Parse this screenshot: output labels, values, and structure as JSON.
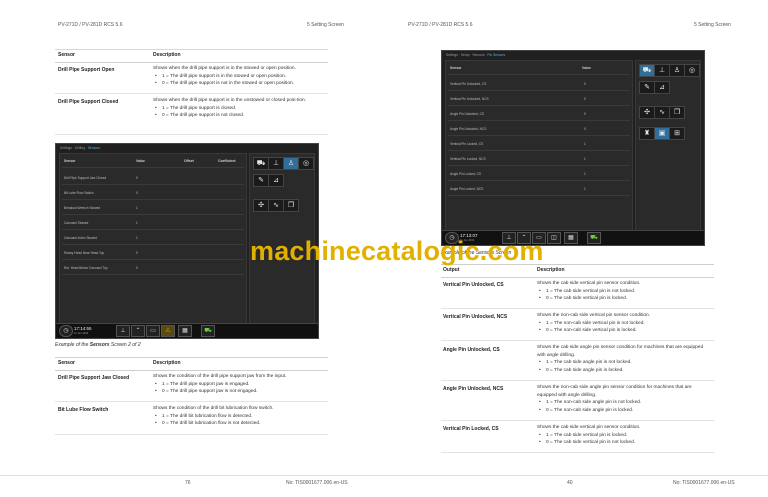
{
  "left_page": {
    "header_left": "PV-271D / PV-281D RCS 5.6",
    "header_right": "5 Setting Screen",
    "table1": {
      "col_sensor": "Sensor",
      "col_desc": "Description",
      "rows": [
        {
          "name": "Drill Pipe Support Open",
          "desc": "Shows when the drill pipe support is in the stowed or open position.",
          "bullets": [
            "1 = The drill pipe support is in the stowed or open position.",
            "0 = The drill pipe support is not in the stowed or open position."
          ]
        },
        {
          "name": "Drill Pipe Support Closed",
          "desc": "Shows when the drill pipe support is in the unstowed or closed posi-tion.",
          "bullets": [
            "1 = The drill pipe support is closed.",
            "0 = The drill pipe support is not closed."
          ]
        }
      ]
    },
    "screen": {
      "breadcrumb": "Settings · Drilling · ",
      "breadcrumb_active": "Sensors",
      "headers": [
        "Sensor",
        "Value",
        "Offset",
        "Coefficient"
      ],
      "rows": [
        {
          "name": "Drill Pipe Support Jaw Closed",
          "value": "0"
        },
        {
          "name": "Bit Lube Flow Switch",
          "value": "0"
        },
        {
          "name": "Breakout Wrench Stowed",
          "value": "1"
        },
        {
          "name": "Carousel Stowed",
          "value": "1"
        },
        {
          "name": "Carousel Index Stowed",
          "value": "1"
        },
        {
          "name": "Rotary Head Near Head Top",
          "value": "0"
        },
        {
          "name": "Rot. Head Below Carousel Top",
          "value": "0"
        }
      ],
      "clock": "17:14:55",
      "date": "11 Jun 2019"
    },
    "caption_prefix": "Example of the ",
    "caption_bold": "Sensors",
    "caption_suffix": " Screen 2 of 2",
    "table2": {
      "col_sensor": "Sensor",
      "col_desc": "Description",
      "rows": [
        {
          "name": "Drill Pipe Support Jaw Closed",
          "desc": "Shows the condition of the drill pipe support jaw from the input.",
          "bullets": [
            "1 = The drill pipe support jaw is engaged.",
            "0 = The drill pipe support jaw is not engaged."
          ]
        },
        {
          "name": "Bit Lube Flow Switch",
          "desc": "Shows the condition of the drill bit lubrication flow switch.",
          "bullets": [
            "1 = The drill bit lubrication flow is detected.",
            "0 = The drill bit lubrication flow is not detected."
          ]
        }
      ]
    },
    "page_number": "76",
    "doc_number": "No: TIS0001677.006 en-US"
  },
  "right_page": {
    "header_left": "PV-271D / PV-281D RCS 5.6",
    "header_right": "5 Setting Screen",
    "screen": {
      "breadcrumb": "Settings · Setup · Sensors · ",
      "breadcrumb_active": "Pin Sensors",
      "headers": [
        "Sensor",
        "Value"
      ],
      "rows": [
        {
          "name": "Vertical Pin Unlocked, CS",
          "value": "0"
        },
        {
          "name": "Vertical Pin Unlocked, NCS",
          "value": "0"
        },
        {
          "name": "Angle Pin Unlocked, CS",
          "value": "0"
        },
        {
          "name": "Angle Pin Unlocked, NCS",
          "value": "0"
        },
        {
          "name": "Vertical Pin Locked, CS",
          "value": "1"
        },
        {
          "name": "Vertical Pin Locked, NCS",
          "value": "1"
        },
        {
          "name": "Angle Pin Locked, CS",
          "value": "1"
        },
        {
          "name": "Angle Pin Locked, NCS",
          "value": "1"
        }
      ],
      "clock": "17:13:07",
      "date": "11 Jun 2019"
    },
    "caption": "Example of the Sensors Screen",
    "table": {
      "col_output": "Output",
      "col_desc": "Description",
      "rows": [
        {
          "name": "Vertical Pin Unlocked, CS",
          "desc": "Shows the cab side vertical pin sensor condition.",
          "bullets": [
            "1 = The cab side vertical pin is not locked.",
            "0 = The cab side vertical pin is locked."
          ]
        },
        {
          "name": "Vertical Pin Unlocked, NCS",
          "desc": "Shows the non-cab side vertical pin sensor condition.",
          "bullets": [
            "1 = The non-cab side vertical pin is not locked.",
            "0 = The non-cab side vertical pin is locked."
          ]
        },
        {
          "name": "Angle Pin Unlocked, CS",
          "desc": "Shows the cab side angle pin sensor condition for machines that are equipped with angle drilling.",
          "bullets": [
            "1 = The cab side angle pin is not locked.",
            "0 = The cab side angle pin is locked."
          ]
        },
        {
          "name": "Angle Pin Unlocked, NCS",
          "desc": "Shows the non-cab side angle pin sensor condition for machines that are equipped with angle drilling.",
          "bullets": [
            "1 = The non-cab side angle pin is not locked.",
            "0 = The non-cab side angle pin is locked."
          ]
        },
        {
          "name": "Vertical Pin Locked, CS",
          "desc": "Shows the cab side vertical pin sensor condition.",
          "bullets": [
            "1 = The cab side vertical pin is locked.",
            "0 = The cab side vertical pin is not locked."
          ]
        }
      ]
    },
    "page_number": "40",
    "doc_number": "No: TIS0001677.006 en-US"
  },
  "watermark": "machinecatalogic.com",
  "colors": {
    "accent": "#4fb3e6",
    "watermark": "#e2b100",
    "screen_bg": "#202020",
    "selected_icon": "#2f6f9a"
  }
}
